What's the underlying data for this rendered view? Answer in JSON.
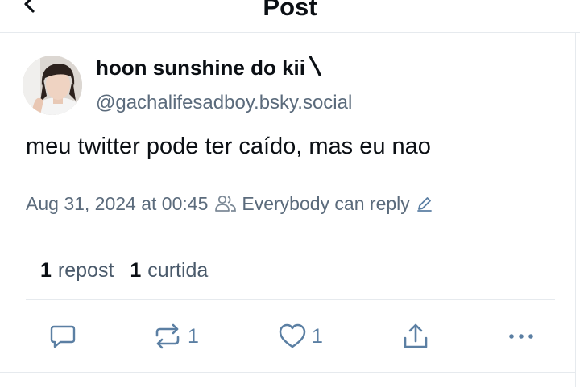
{
  "header": {
    "title": "Post"
  },
  "post": {
    "author_name": "hoon sunshine do kii〵",
    "handle": "@gachalifesadboy.bsky.social",
    "text": "meu twitter pode ter caído, mas eu nao",
    "timestamp": "Aug 31, 2024 at 00:45",
    "reply_setting": "Everybody can reply"
  },
  "stats": {
    "repost_count": "1",
    "repost_label": "repost",
    "like_count": "1",
    "like_label": "curtida"
  },
  "actions": {
    "repost_count": "1",
    "like_count": "1"
  },
  "icons": {
    "back": "chevron-left-icon",
    "people": "people-icon",
    "edit": "pencil-icon",
    "reply": "comment-icon",
    "repost": "repost-icon",
    "like": "heart-icon",
    "share": "share-icon",
    "more": "more-icon"
  },
  "colors": {
    "icon_blue": "#5b7fa3",
    "muted": "#5b6b7c",
    "divider": "#e6eaee"
  }
}
